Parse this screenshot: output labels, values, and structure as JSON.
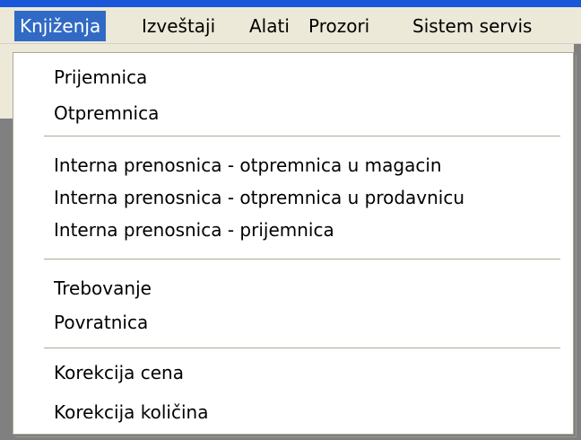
{
  "menubar": {
    "items": [
      {
        "label": "Knjiženja"
      },
      {
        "label": "Izveštaji"
      },
      {
        "label": "Alati"
      },
      {
        "label": "Prozori"
      },
      {
        "label": "Sistem servis"
      }
    ]
  },
  "dropdown": {
    "groups": [
      {
        "items": [
          {
            "label": "Prijemnica"
          },
          {
            "label": "Otpremnica"
          }
        ]
      },
      {
        "items": [
          {
            "label": "Interna prenosnica - otpremnica u magacin"
          },
          {
            "label": "Interna prenosnica - otpremnica u prodavnicu"
          },
          {
            "label": "Interna prenosnica - prijemnica"
          }
        ]
      },
      {
        "items": [
          {
            "label": "Trebovanje"
          },
          {
            "label": "Povratnica"
          }
        ]
      },
      {
        "items": [
          {
            "label": "Korekcija cena"
          },
          {
            "label": "Korekcija količina"
          }
        ]
      }
    ]
  },
  "colors": {
    "menubar_bg": "#ece9d8",
    "highlight": "#316ac5",
    "titlebar": "#1a57d8"
  }
}
